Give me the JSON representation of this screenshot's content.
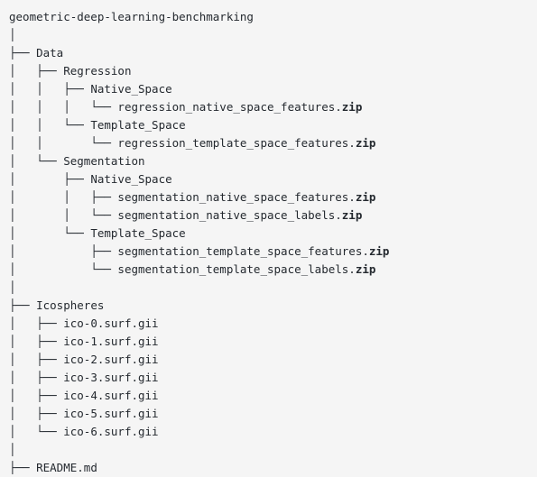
{
  "view": {
    "kind": "directory-tree",
    "background_color": "#f5f5f5",
    "text_color": "#24292f",
    "root_label": "geometric-deep-learning-benchmarking"
  },
  "tree": {
    "lines": [
      {
        "prefix": "",
        "name": "geometric-deep-learning-benchmarking",
        "bold_suffix": ""
      },
      {
        "prefix": "│",
        "name": "",
        "bold_suffix": ""
      },
      {
        "prefix": "├── ",
        "name": "Data",
        "bold_suffix": ""
      },
      {
        "prefix": "│   ├── ",
        "name": "Regression",
        "bold_suffix": ""
      },
      {
        "prefix": "│   │   ├── ",
        "name": "Native_Space",
        "bold_suffix": ""
      },
      {
        "prefix": "│   │   │   └── ",
        "name": "regression_native_space_features.",
        "bold_suffix": "zip"
      },
      {
        "prefix": "│   │   └── ",
        "name": "Template_Space",
        "bold_suffix": ""
      },
      {
        "prefix": "│   │       └── ",
        "name": "regression_template_space_features.",
        "bold_suffix": "zip"
      },
      {
        "prefix": "│   └── ",
        "name": "Segmentation",
        "bold_suffix": ""
      },
      {
        "prefix": "│       ├── ",
        "name": "Native_Space",
        "bold_suffix": ""
      },
      {
        "prefix": "│       │   ├── ",
        "name": "segmentation_native_space_features.",
        "bold_suffix": "zip"
      },
      {
        "prefix": "│       │   └── ",
        "name": "segmentation_native_space_labels.",
        "bold_suffix": "zip"
      },
      {
        "prefix": "│       └── ",
        "name": "Template_Space",
        "bold_suffix": ""
      },
      {
        "prefix": "│           ├── ",
        "name": "segmentation_template_space_features.",
        "bold_suffix": "zip"
      },
      {
        "prefix": "│           └── ",
        "name": "segmentation_template_space_labels.",
        "bold_suffix": "zip"
      },
      {
        "prefix": "│",
        "name": "",
        "bold_suffix": ""
      },
      {
        "prefix": "├── ",
        "name": "Icospheres",
        "bold_suffix": ""
      },
      {
        "prefix": "│   ├── ",
        "name": "ico-0.surf.gii",
        "bold_suffix": ""
      },
      {
        "prefix": "│   ├── ",
        "name": "ico-1.surf.gii",
        "bold_suffix": ""
      },
      {
        "prefix": "│   ├── ",
        "name": "ico-2.surf.gii",
        "bold_suffix": ""
      },
      {
        "prefix": "│   ├── ",
        "name": "ico-3.surf.gii",
        "bold_suffix": ""
      },
      {
        "prefix": "│   ├── ",
        "name": "ico-4.surf.gii",
        "bold_suffix": ""
      },
      {
        "prefix": "│   ├── ",
        "name": "ico-5.surf.gii",
        "bold_suffix": ""
      },
      {
        "prefix": "│   └── ",
        "name": "ico-6.surf.gii",
        "bold_suffix": ""
      },
      {
        "prefix": "│",
        "name": "",
        "bold_suffix": ""
      },
      {
        "prefix": "├── ",
        "name": "README.md",
        "bold_suffix": ""
      }
    ]
  }
}
